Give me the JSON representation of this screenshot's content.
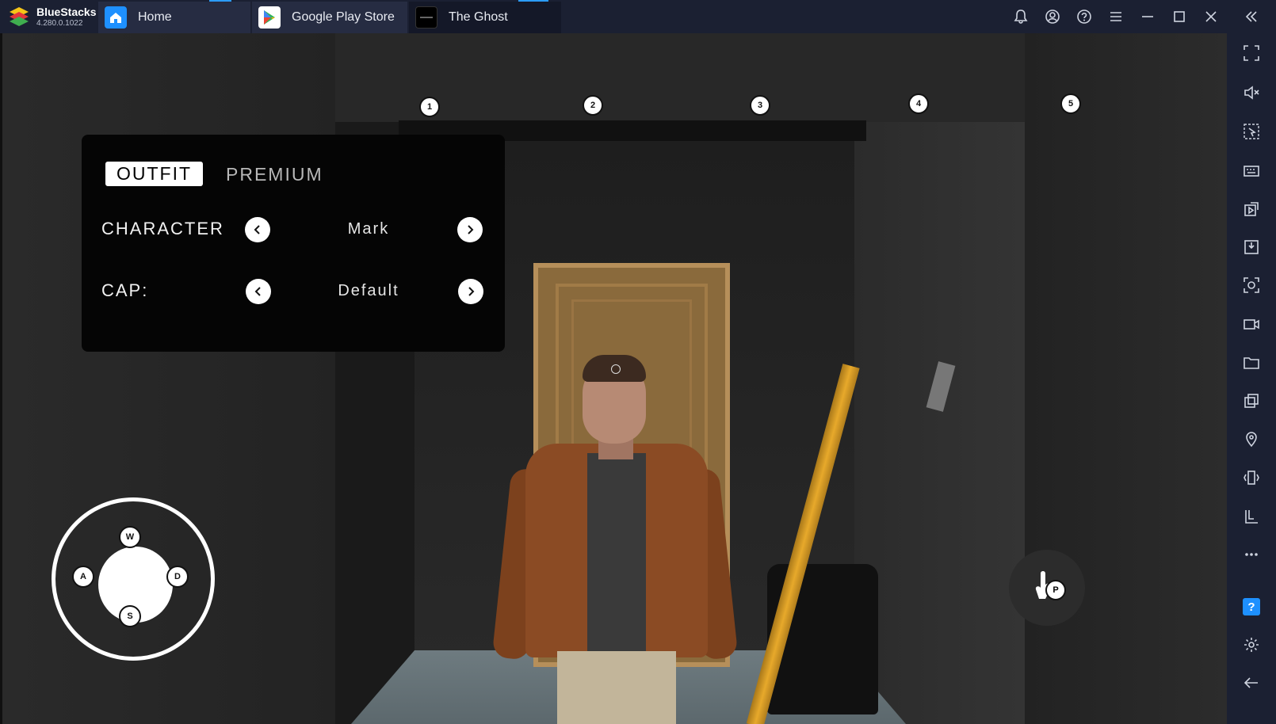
{
  "app": {
    "brand_name": "BlueStacks",
    "version": "4.280.0.1022",
    "accent_color": "#2c9cff"
  },
  "tabs": [
    {
      "label": "Home",
      "icon": "home-icon"
    },
    {
      "label": "Google Play Store",
      "icon": "play-store-icon"
    },
    {
      "label": "The Ghost",
      "icon": "game-thumbnail-icon",
      "active": true
    }
  ],
  "title_actions": [
    "bell-icon",
    "account-icon",
    "help-icon",
    "menu-icon",
    "minimize-icon",
    "maximize-icon",
    "close-icon",
    "collapse-sidebar-icon"
  ],
  "game": {
    "markers": [
      "1",
      "2",
      "3",
      "4",
      "5"
    ],
    "outfit_panel": {
      "tab_outfit": "OUTFIT",
      "tab_premium": "PREMIUM",
      "character_label": "CHARACTER",
      "character_value": "Mark",
      "cap_label": "CAP:",
      "cap_value": "Default"
    },
    "joystick_keys": {
      "up": "W",
      "left": "A",
      "right": "D",
      "down": "S"
    },
    "action_key": "P"
  },
  "sidebar": {
    "items": [
      "fullscreen-icon",
      "mute-icon",
      "pointer-select-icon",
      "keyboard-icon",
      "media-import-icon",
      "apk-install-icon",
      "screenshot-icon",
      "record-icon",
      "folder-icon",
      "multi-instance-icon",
      "location-icon",
      "shake-icon",
      "rotate-icon",
      "more-icon",
      "help-icon",
      "settings-icon",
      "back-icon"
    ],
    "help_label": "?"
  }
}
